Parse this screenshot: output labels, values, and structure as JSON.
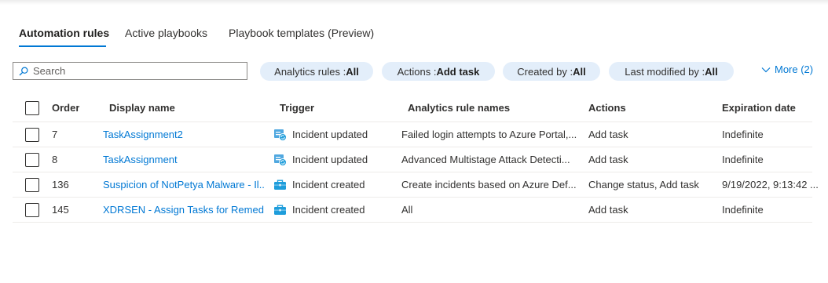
{
  "tabs": [
    {
      "label": "Automation rules",
      "active": true
    },
    {
      "label": "Active playbooks",
      "active": false
    },
    {
      "label": "Playbook templates (Preview)",
      "active": false
    }
  ],
  "search": {
    "placeholder": "Search",
    "value": ""
  },
  "filters": [
    {
      "label": "Analytics rules : ",
      "value": "All"
    },
    {
      "label": "Actions : ",
      "value": "Add task"
    },
    {
      "label": "Created by : ",
      "value": "All"
    },
    {
      "label": "Last modified by : ",
      "value": "All"
    }
  ],
  "more_label": "More (2)",
  "table": {
    "columns": [
      "Order",
      "Display name",
      "Trigger",
      "Analytics rule names",
      "Actions",
      "Expiration date"
    ],
    "rows": [
      {
        "order": "7",
        "name": "TaskAssignment2",
        "trigger": "Incident updated",
        "trigger_icon": "incident-updated-icon",
        "rule_names": "Failed login attempts to Azure Portal,...",
        "actions": "Add task",
        "expiration": "Indefinite"
      },
      {
        "order": "8",
        "name": "TaskAssignment",
        "trigger": "Incident updated",
        "trigger_icon": "incident-updated-icon",
        "rule_names": "Advanced Multistage Attack Detecti...",
        "actions": "Add task",
        "expiration": "Indefinite"
      },
      {
        "order": "136",
        "name": "Suspicion of NotPetya Malware - Il...",
        "trigger": "Incident created",
        "trigger_icon": "incident-created-icon",
        "rule_names": "Create incidents based on Azure Def...",
        "actions": "Change status, Add task",
        "expiration": "9/19/2022, 9:13:42 ..."
      },
      {
        "order": "145",
        "name": "XDRSEN - Assign Tasks for Remedi...",
        "trigger": "Incident created",
        "trigger_icon": "incident-created-icon",
        "rule_names": "All",
        "actions": "Add task",
        "expiration": "Indefinite"
      }
    ]
  },
  "colors": {
    "accent": "#0078d4",
    "pill_bg": "#e3eefa",
    "icon_teal": "#1e9ddb"
  }
}
